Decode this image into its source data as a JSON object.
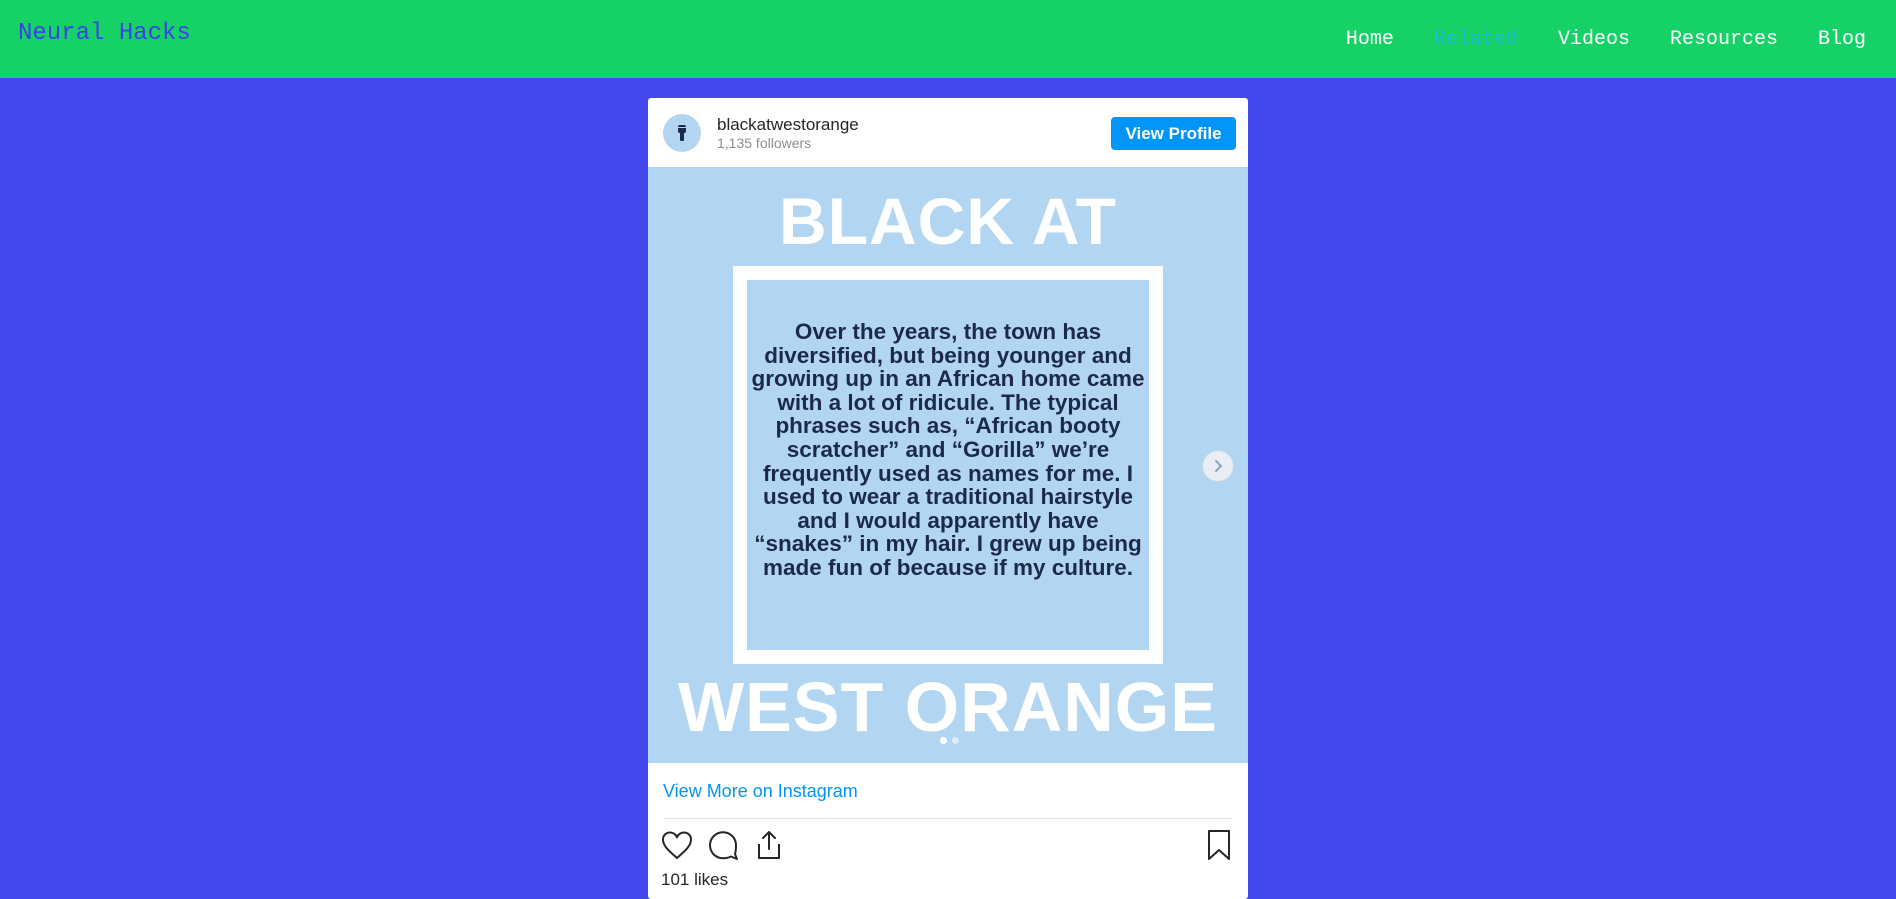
{
  "navbar": {
    "brand": "Neural Hacks",
    "links": [
      "Home",
      "Related",
      "Videos",
      "Resources",
      "Blog"
    ],
    "active_link": "Related"
  },
  "post": {
    "username": "blackatwestorange",
    "followers": "1,135 followers",
    "view_profile_label": "View Profile",
    "image": {
      "title_top": "BLACK AT",
      "quote": "Over the years, the town has diversified, but being younger and growing up in an African home came with a lot of ridicule. The typical phrases such as, “African booty scratcher” and “Gorilla” we’re frequently used as names for me. I used to wear a traditional hairstyle and I would apparently have “snakes” in my hair. I grew up being made fun of because if my culture.",
      "title_bottom": "WEST ORANGE",
      "slide_count": 2,
      "current_slide": 1
    },
    "view_more_label": "View More on Instagram",
    "likes": "101 likes"
  },
  "icons": {
    "avatar": "raised-fist-icon",
    "next": "chevron-right-icon",
    "like": "heart-icon",
    "comment": "comment-bubble-icon",
    "share": "share-icon",
    "save": "bookmark-icon"
  },
  "colors": {
    "navbar_bg": "#16d266",
    "page_bg": "#4347ec",
    "brand": "#3a43e6",
    "active_link": "#19bfd0",
    "button_blue": "#0095f6",
    "post_bg": "#b2d6f1"
  }
}
